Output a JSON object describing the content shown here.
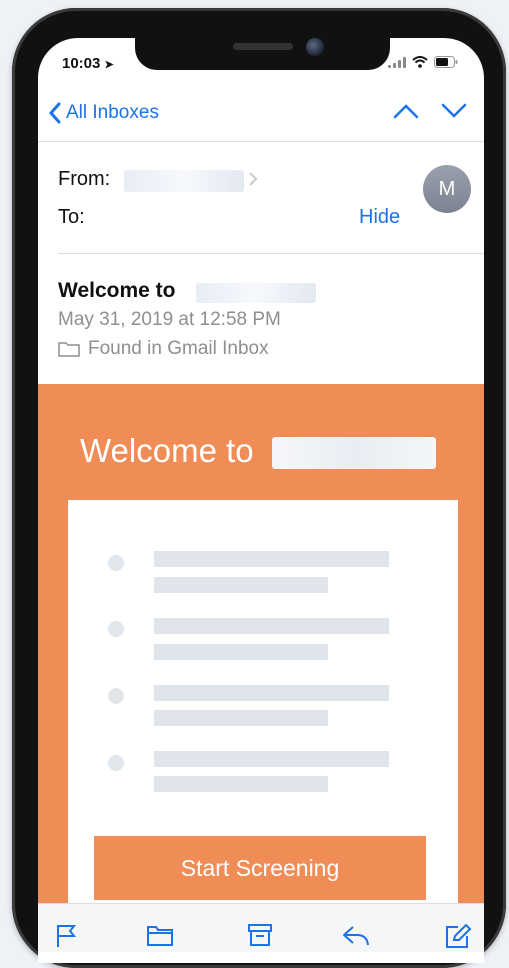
{
  "status_bar": {
    "time": "10:03"
  },
  "nav": {
    "back_label": "All Inboxes"
  },
  "header": {
    "from_label": "From:",
    "to_label": "To:",
    "hide_label": "Hide",
    "avatar_initial": "M"
  },
  "message": {
    "subject_prefix": "Welcome to",
    "date": "May 31, 2019 at 12:58 PM",
    "folder": "Found in Gmail Inbox"
  },
  "email_body": {
    "banner_title_prefix": "Welcome to",
    "cta_label": "Start Screening"
  },
  "colors": {
    "accent_blue": "#1a73e8",
    "banner_orange": "#f08c55"
  },
  "toolbar": {
    "icons": [
      "flag-icon",
      "folder-icon",
      "archive-icon",
      "reply-icon",
      "compose-icon"
    ]
  }
}
